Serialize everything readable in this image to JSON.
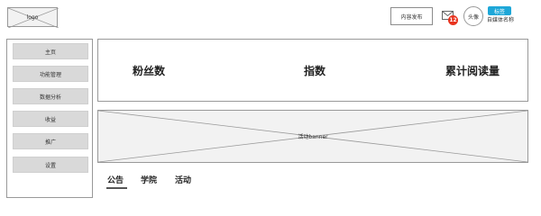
{
  "header": {
    "logo_label": "logo",
    "publish_label": "内容发布",
    "mail_badge_count": "12",
    "avatar_label": "头像",
    "tag_label": "标签",
    "media_name": "自媒体名称"
  },
  "sidebar": {
    "items": [
      {
        "label": "主页"
      },
      {
        "label": "功能管理"
      },
      {
        "label": "数据分析"
      },
      {
        "label": "收益"
      },
      {
        "label": "推广"
      },
      {
        "label": "设置"
      }
    ]
  },
  "stats": {
    "fans_label": "粉丝数",
    "index_label": "指数",
    "reads_label": "累计阅读量"
  },
  "banner": {
    "label": "活动banner"
  },
  "tabs": [
    {
      "label": "公告",
      "active": true
    },
    {
      "label": "学院",
      "active": false
    },
    {
      "label": "活动",
      "active": false
    }
  ],
  "colors": {
    "badge_red": "#e8331f",
    "tag_blue": "#1ea7d8",
    "menu_bg": "#d9d9d9",
    "placeholder_bg": "#f2f2f2"
  },
  "icons": {
    "mail": "envelope-icon"
  }
}
